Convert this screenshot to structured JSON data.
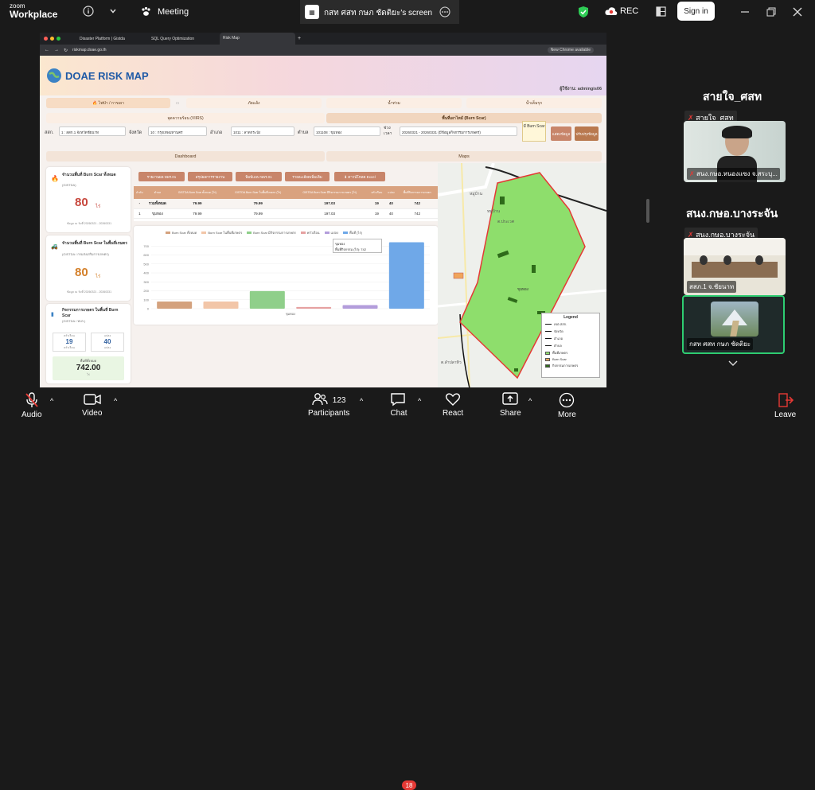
{
  "zoom": {
    "logo_top": "zoom",
    "logo_bottom": "Workplace",
    "meeting_label": "Meeting",
    "screen_title": "กสท ศสท กษภ ชัดติยะ's screen",
    "rec_label": "REC",
    "signin_label": "Sign in",
    "participants_count": "123",
    "chat_badge": "18",
    "controls": {
      "audio": "Audio",
      "video": "Video",
      "participants": "Participants",
      "chat": "Chat",
      "react": "React",
      "share": "Share",
      "more": "More",
      "leave": "Leave"
    },
    "gallery": [
      {
        "name": "สายใจ_ศสท",
        "label_muted": "สายใจ_ศสท",
        "label_bottom": "สนง.กษอ.หนองแซง จ.สระบุ..."
      },
      {
        "name": "สนง.กษอ.บางระจัน",
        "label_muted": "สนง.กษอ.บางระจัน",
        "label_bottom": "สสภ.1 จ.ชัยนาท"
      },
      {
        "name": "",
        "label_muted": "",
        "label_bottom": "กสท ศสท กษภ ชัดติยะ"
      }
    ]
  },
  "browser": {
    "tabs": [
      "Disaster Platform | Gistda",
      "SQL Query Optimization",
      "Risk Map"
    ],
    "url": "riskmap.doae.go.th",
    "new_chrome": "New Chrome available"
  },
  "app": {
    "title": "DOAE RISK MAP",
    "user_label": "ผู้ใช้งาน: admingis06",
    "hazard_tabs": [
      "🔥 ไฟป่า / การเผา",
      "ภัยแล้ง",
      "น้ำท่วม",
      "น้ำเค็มรุก"
    ],
    "sub_tabs": [
      "จุดความร้อน (VIIRS)",
      "พื้นที่เผาไหม้ (Burn Scar)"
    ],
    "filters": {
      "region_label": "สสก.",
      "region_value": "1 : สสก.1 จังหวัดชัยนาท",
      "province_label": "จังหวัด",
      "province_value": "10 : กรุงเทพมหานคร",
      "district_label": "อำเภอ",
      "district_value": "1011 : ลาดกระบัง",
      "subdistrict_label": "ตำบล",
      "subdistrict_value": "101108 : ขุมทอง",
      "period_label": "ช่วงเวลา",
      "period_value": "20260321 - 20260331 (มีข้อมูลกิจกรรมการเกษตร)",
      "layer_btn": "มี Burn Scar",
      "btn_show": "แสดงข้อมูล",
      "btn_refresh": "ปรับปรุงข้อมูล"
    },
    "view_tabs": [
      "Dashboard",
      "Maps"
    ],
    "kpis": [
      {
        "title": "จำนวนพื้นที่ Burn Scar ทั้งหมด",
        "sub": "(GISTDA)",
        "value": "80",
        "unit": "ไร่",
        "date": "ข้อมูล ณ วันที่ 20260321 - 20260331"
      },
      {
        "title": "จำนวนพื้นที่ Burn Scar ในพื้นที่เกษตร",
        "sub": "(GISTDA / กรมส่งเสริมการเกษตร)",
        "value": "80",
        "unit": "ไร่",
        "date": "ข้อมูล ณ วันที่ 20260321 - 20260331"
      },
      {
        "title": "กิจกรรมการเกษตร ในพื้นที่ Burn Scar",
        "sub": "(GISTDA / ทบก.)",
        "value": "",
        "unit": "",
        "date": ""
      }
    ],
    "activity": {
      "label_a": "ครัวเรือน",
      "value_a": "19",
      "unit_a": "ครัวเรือน",
      "label_b": "แปลง",
      "value_b": "40",
      "unit_b": "แปลง",
      "area_label": "พื้นที่ทั้งหมด",
      "area_value": "742.00",
      "area_unit": "ไร่"
    },
    "action_buttons": [
      "รายงานผล พพร.01",
      "สรุปผลการรายงาน",
      "พิมพ์แบบ พพร.01",
      "รายละเอียดเพิ่มเติม",
      "⬇ ดาวน์โหลด Excel"
    ],
    "table": {
      "headers": [
        "ลำดับ",
        "ตำบล",
        "GISTDA Burn Scar ทั้งหมด (ไร่)",
        "GISTDA Burn Scar ในพื้นที่เกษตร (ไร่)",
        "GISTDA Burn Scar มีกิจกรรมการเกษตร (ไร่)",
        "ครัวเรือน",
        "แปลง",
        "พื้นที่กิจกรรมการเกษตร"
      ],
      "rows": [
        [
          "-",
          "รวมทั้งหมด",
          "79.99",
          "79.99",
          "197.03",
          "19",
          "40",
          "742"
        ],
        [
          "1",
          "ขุมทอง",
          "79.99",
          "79.99",
          "197.03",
          "19",
          "40",
          "742"
        ]
      ]
    },
    "legend_title": "Legend",
    "legend": [
      "เขต สสก.",
      "จังหวัด",
      "อำเภอ",
      "ตำบล",
      "พื้นที่เกษตร",
      "Burn Scar",
      "กิจกรรมการเกษตร"
    ],
    "map_labels": [
      "หมู่บ้าน",
      "หมู่บ้าน",
      "ต.ประเวศ",
      "ขุมทอง",
      "ต.ลำปลาทิว"
    ]
  },
  "chart_data": {
    "type": "bar",
    "categories": [
      "ขุมทอง"
    ],
    "series": [
      {
        "name": "Burn Scar ทั้งหมด",
        "values": [
          79.99
        ],
        "color": "#d4a27e"
      },
      {
        "name": "Burn Scar ในพื้นที่เกษตร",
        "values": [
          79.99
        ],
        "color": "#f2c6a8"
      },
      {
        "name": "Burn Scar มีกิจกรรมการเกษตร",
        "values": [
          197.03
        ],
        "color": "#8fcf8a"
      },
      {
        "name": "ครัวเรือน",
        "values": [
          19
        ],
        "color": "#e6a1a1"
      },
      {
        "name": "แปลง",
        "values": [
          40
        ],
        "color": "#b39ddb"
      },
      {
        "name": "พื้นที่ (ไร่)",
        "values": [
          742
        ],
        "color": "#6fa8e8"
      }
    ],
    "ylim": [
      0,
      800
    ],
    "yticks": [
      0,
      100,
      200,
      300,
      400,
      500,
      600,
      700
    ],
    "tooltip": {
      "title": "ขุมทอง",
      "text": "พื้นที่กิจกรรม (ไร่): 742"
    },
    "grid": true,
    "legend_position": "top"
  }
}
